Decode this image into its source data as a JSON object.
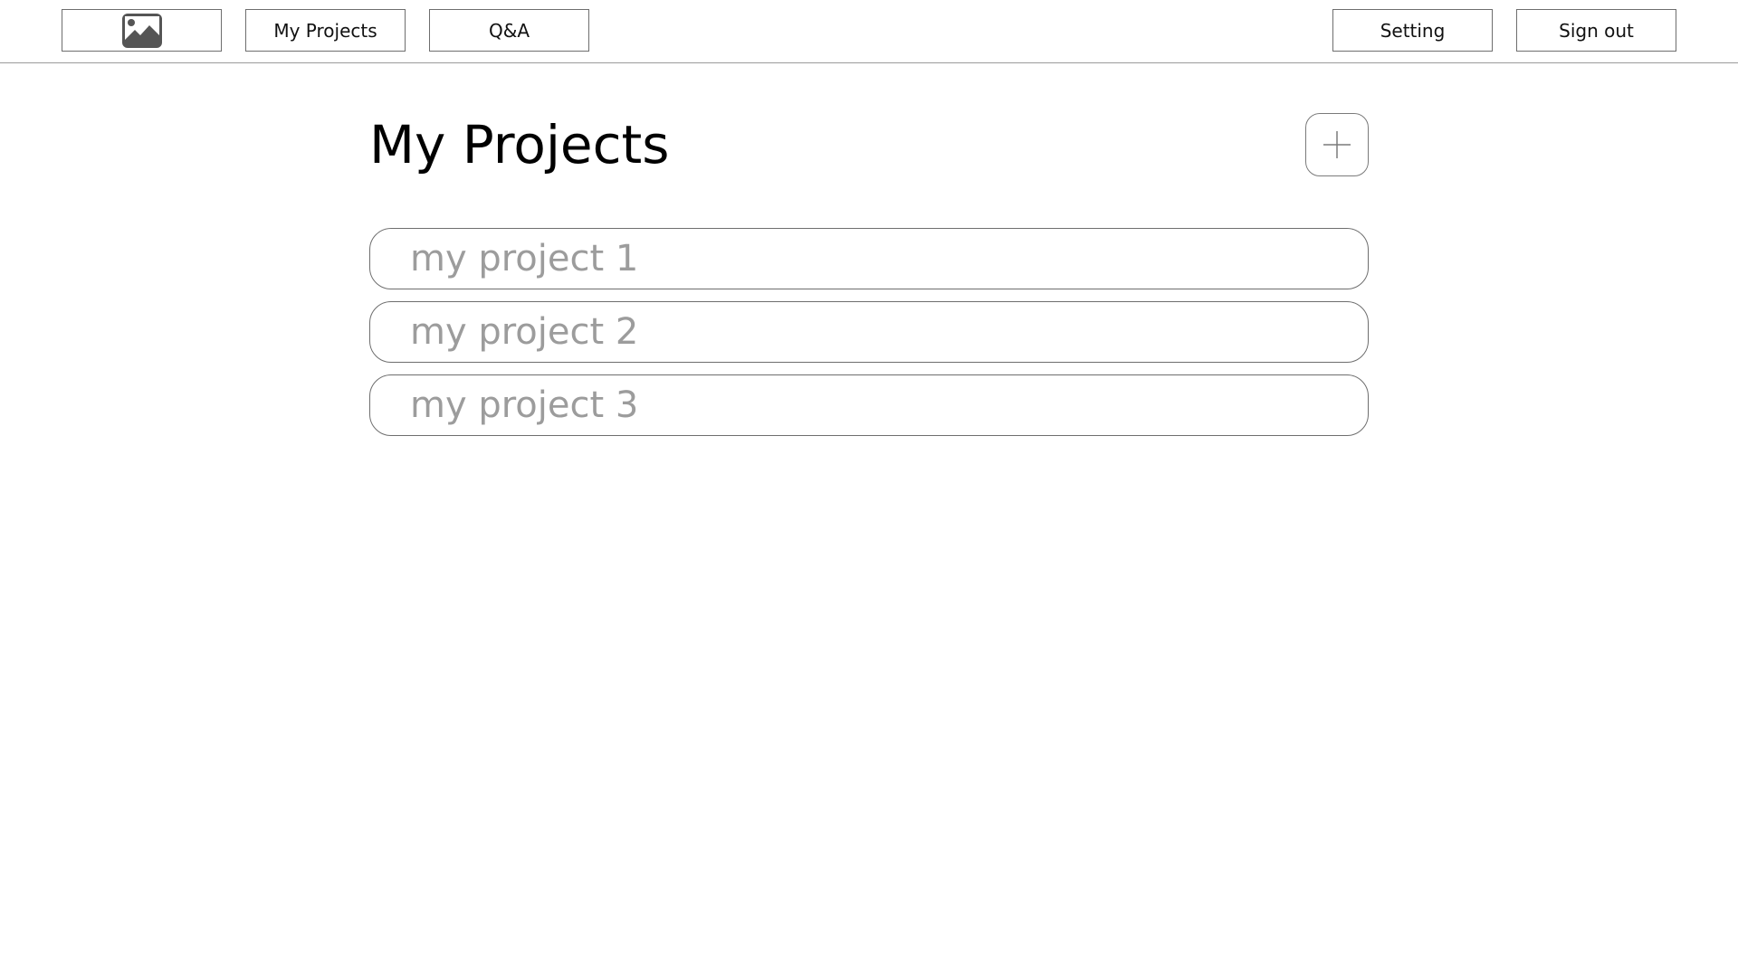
{
  "nav": {
    "logo_icon": "image-placeholder-icon",
    "my_projects_label": "My Projects",
    "qa_label": "Q&A",
    "setting_label": "Setting",
    "sign_out_label": "Sign out"
  },
  "main": {
    "title": "My Projects",
    "add_icon": "plus-icon",
    "projects": [
      {
        "label": "my project 1"
      },
      {
        "label": "my project 2"
      },
      {
        "label": "my project 3"
      }
    ]
  },
  "colors": {
    "border": "#6e6e6e",
    "project_text": "#9c9c9c",
    "icon_fill": "#555555"
  }
}
